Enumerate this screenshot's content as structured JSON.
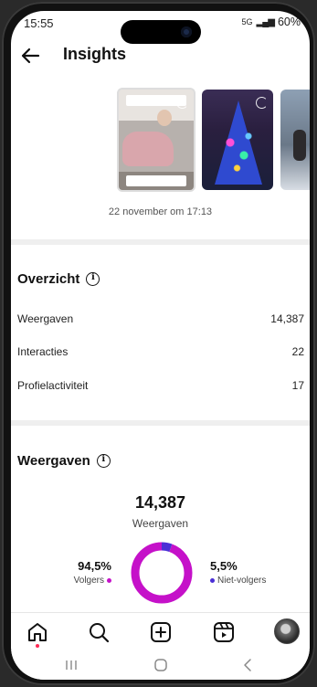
{
  "status_bar": {
    "time": "15:55",
    "battery": "60%",
    "network": "5G"
  },
  "header": {
    "title": "Insights",
    "back_icon": "arrow-left-icon"
  },
  "story": {
    "date": "22 november om 17:13"
  },
  "overview": {
    "title": "Overzicht",
    "rows": [
      {
        "label": "Weergaven",
        "value": "14,387"
      },
      {
        "label": "Interacties",
        "value": "22"
      },
      {
        "label": "Profielactiviteit",
        "value": "17"
      }
    ]
  },
  "views": {
    "title": "Weergaven",
    "total_value": "14,387",
    "total_label": "Weergaven",
    "followers_pct": "94,5%",
    "followers_label": "Volgers",
    "nonfollowers_pct": "5,5%",
    "nonfollowers_label": "Niet-volgers",
    "followers_fraction": 0.945,
    "followers_color": "#c511c9",
    "nonfollowers_color": "#4a2fd6"
  },
  "bottom_nav": {
    "items": [
      "home-icon",
      "search-icon",
      "create-icon",
      "reels-icon",
      "profile-avatar"
    ]
  },
  "colors": {
    "accent_pink": "#c511c9",
    "accent_purple": "#4a2fd6",
    "notification_red": "#ff2a55"
  }
}
